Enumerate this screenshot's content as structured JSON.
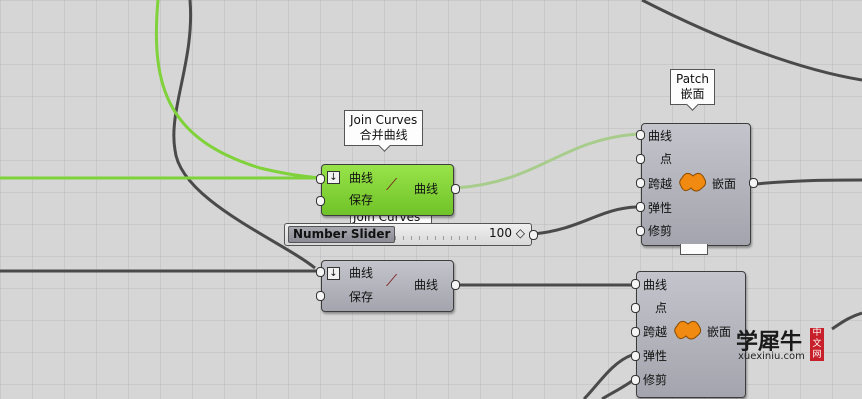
{
  "canvas": {
    "background": "#d6d6d6",
    "wire_grey": "#4a4a4a",
    "wire_green": "#7fd23a"
  },
  "tooltips": {
    "join_curves": {
      "line1": "Join Curves",
      "line2": "合并曲线"
    },
    "patch": {
      "line1": "Patch",
      "line2": "嵌面"
    },
    "behind_label": "Join Curves"
  },
  "join_top": {
    "inputs": [
      "曲线",
      "保存"
    ],
    "output": "曲线",
    "toggle_icon": "arrow-down-icon",
    "tool_icon": "join-curves-icon",
    "state": "selected",
    "color": "#7fd23a"
  },
  "join_bottom": {
    "inputs": [
      "曲线",
      "保存"
    ],
    "output": "曲线",
    "toggle_icon": "arrow-down-icon",
    "tool_icon": "join-curves-icon",
    "color": "#b4b4bc"
  },
  "slider": {
    "name": "Number Slider",
    "value": "100 ◇"
  },
  "patch_top": {
    "inputs": [
      "曲线",
      "点",
      "跨越",
      "弹性",
      "修剪"
    ],
    "output": "嵌面",
    "icon": "patch-icon",
    "icon_color": "#f08a10"
  },
  "patch_bottom": {
    "inputs": [
      "曲线",
      "点",
      "跨越",
      "弹性",
      "修剪"
    ],
    "output": "嵌面",
    "icon": "patch-icon",
    "icon_color": "#f08a10"
  },
  "watermark": {
    "title": "学犀牛",
    "url": "xuexiniu.com",
    "seal": "中文网"
  }
}
